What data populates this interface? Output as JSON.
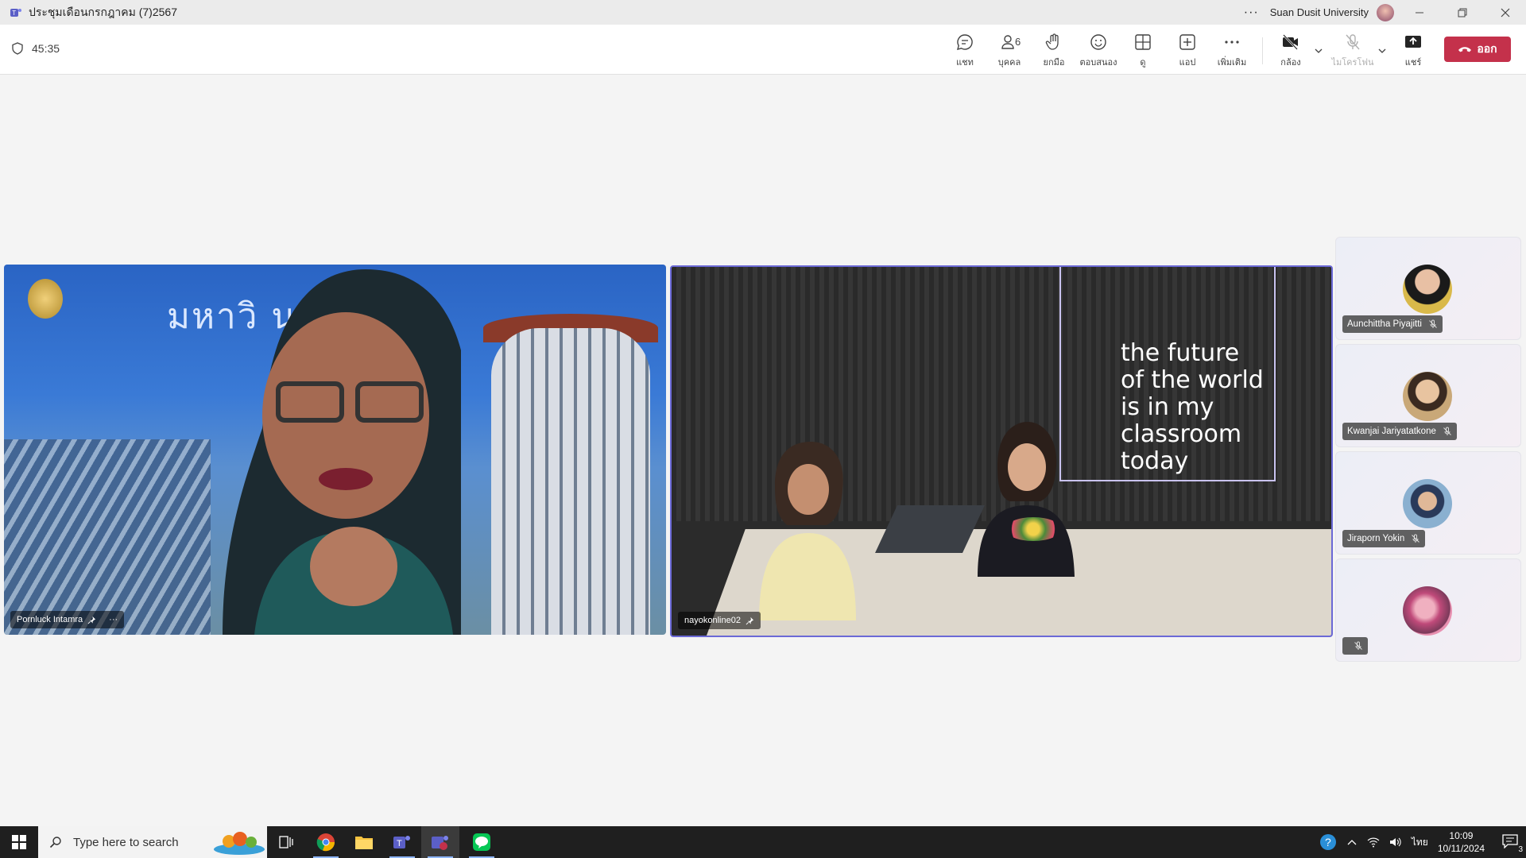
{
  "window": {
    "title": "ประชุมเดือนกรกฎาคม (7)2567",
    "org": "Suan Dusit University",
    "more": "···"
  },
  "toolbar": {
    "timer": "45:35",
    "people_count": "6",
    "buttons": {
      "chat": "แชท",
      "people": "บุคคล",
      "raise": "ยกมือ",
      "react": "ตอบสนอง",
      "view": "ดู",
      "apps": "แอป",
      "more": "เพิ่มเติม",
      "camera": "กล้อง",
      "mic": "ไมโครโฟน",
      "share": "แชร์"
    },
    "leave": "ออก"
  },
  "main_tiles": [
    {
      "name": "Pornluck Intamra",
      "bg_text": "มหาวิ    นดุสิต"
    },
    {
      "name": "nayokonline02",
      "quote": [
        "the future",
        "of the world",
        "is in my",
        "classroom",
        "today"
      ]
    }
  ],
  "side_tiles": [
    {
      "name": "Aunchittha Piyajitti"
    },
    {
      "name": "Kwanjai Jariyatatkone"
    },
    {
      "name": "Jiraporn Yokin"
    },
    {
      "name": ""
    }
  ],
  "taskbar": {
    "search_placeholder": "Type here to search",
    "lang": "ไทย",
    "time": "10:09",
    "date": "10/11/2024",
    "notif_count": "3"
  },
  "colors": {
    "leave": "#c4314b",
    "active_border": "#6b69d6",
    "teams_purple": "#5b5fc7"
  }
}
